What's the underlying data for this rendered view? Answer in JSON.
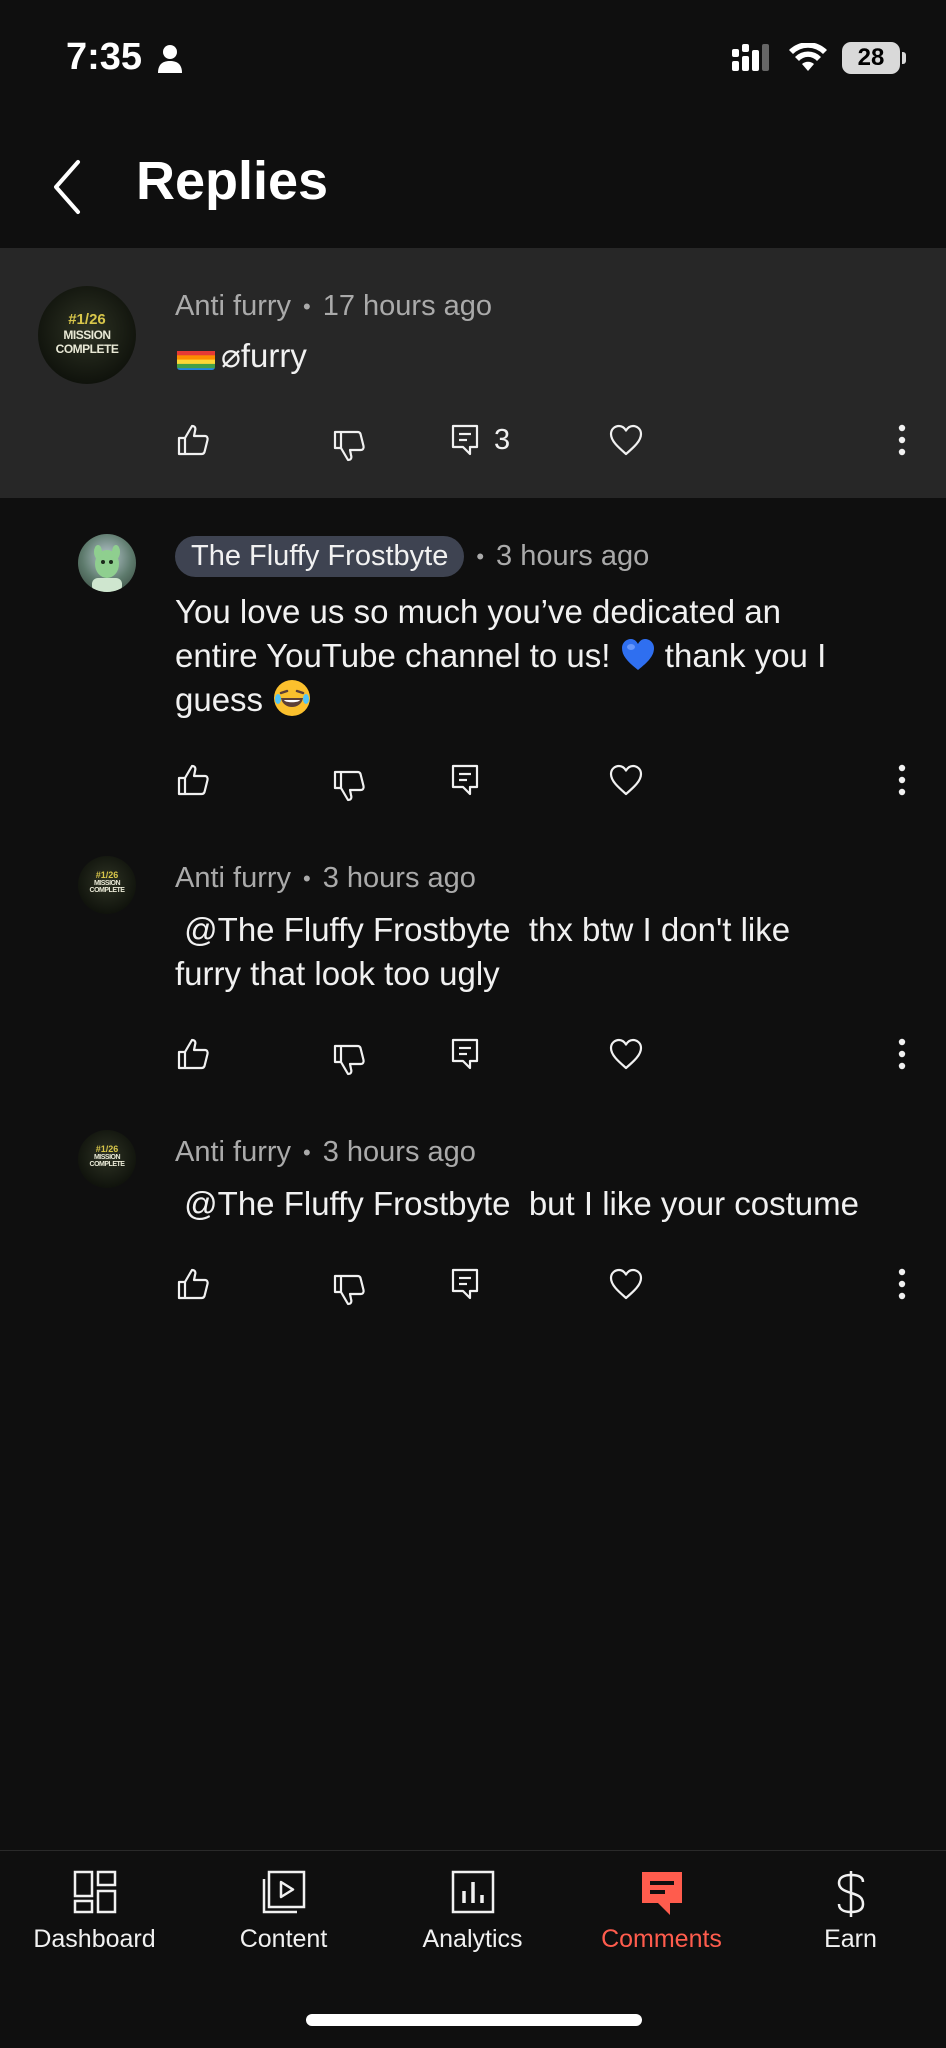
{
  "status_bar": {
    "time": "7:35",
    "battery": "28"
  },
  "header": {
    "title": "Replies"
  },
  "parent_comment": {
    "avatar_text": "MISSION COMPLETE",
    "avatar_rank": "#1/26",
    "author": "Anti furry",
    "time": "17 hours ago",
    "text": "⌀furry",
    "reply_count": "3"
  },
  "replies": [
    {
      "author": "The Fluffy Frostbyte",
      "is_owner": true,
      "time": "3 hours ago",
      "text_line1": "You love us so much you’ve dedicated an",
      "text_line2a": "entire YouTube channel to us! ",
      "text_line2b": " thank you I",
      "text_line3": "guess "
    },
    {
      "author": "Anti furry",
      "time": "3 hours ago",
      "avatar_text": "MISSION COMPLETE",
      "avatar_rank": "#1/26",
      "text_line1": " @The Fluffy Frostbyte  thx btw I don't like",
      "text_line2": "furry that look too ugly"
    },
    {
      "author": "Anti furry",
      "time": "3 hours ago",
      "avatar_text": "MISSION COMPLETE",
      "avatar_rank": "#1/26",
      "text_line1": " @The Fluffy Frostbyte  but I like your costume"
    }
  ],
  "meta_separator": "•",
  "bottom_nav": {
    "items": [
      {
        "label": "Dashboard",
        "icon": "dashboard-icon"
      },
      {
        "label": "Content",
        "icon": "content-icon"
      },
      {
        "label": "Analytics",
        "icon": "analytics-icon"
      },
      {
        "label": "Comments",
        "icon": "comments-icon",
        "active": true
      },
      {
        "label": "Earn",
        "icon": "dollar-icon"
      }
    ]
  },
  "colors": {
    "background": "#0f0f0f",
    "parent_highlight": "#272727",
    "active_accent": "#ff5c4d",
    "owner_chip": "#3e4351"
  }
}
